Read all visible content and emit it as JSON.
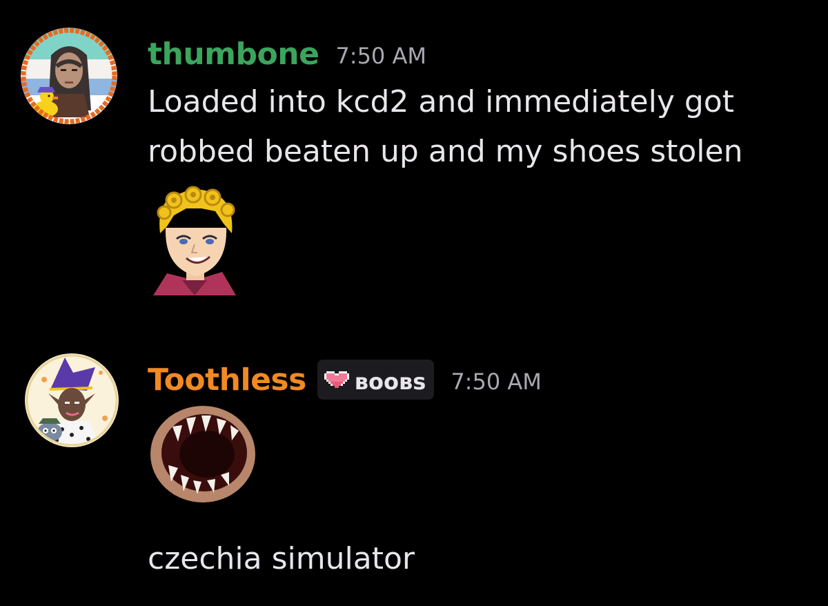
{
  "messages": [
    {
      "username": "thumbone",
      "username_color": "#3ba55d",
      "timestamp": "7:50 AM",
      "lines": [
        "Loaded into kcd2 and immediately got",
        "robbed beaten up and my shoes stolen"
      ],
      "avatar": "pixel-frame-avatar-hooded-figure-with-duck",
      "emoji": "blonde-anime-character-smiling-emoji"
    },
    {
      "username": "Toothless",
      "username_color": "#f08a24",
      "tag": {
        "icon": "pixel-heart-icon",
        "text": "ʙᴏᴏʙs"
      },
      "timestamp": "7:50 AM",
      "lines": [
        "czechia simulator"
      ],
      "avatar": "purple-hat-character-avatar",
      "emoji": "toothy-mouth-emoji"
    }
  ]
}
